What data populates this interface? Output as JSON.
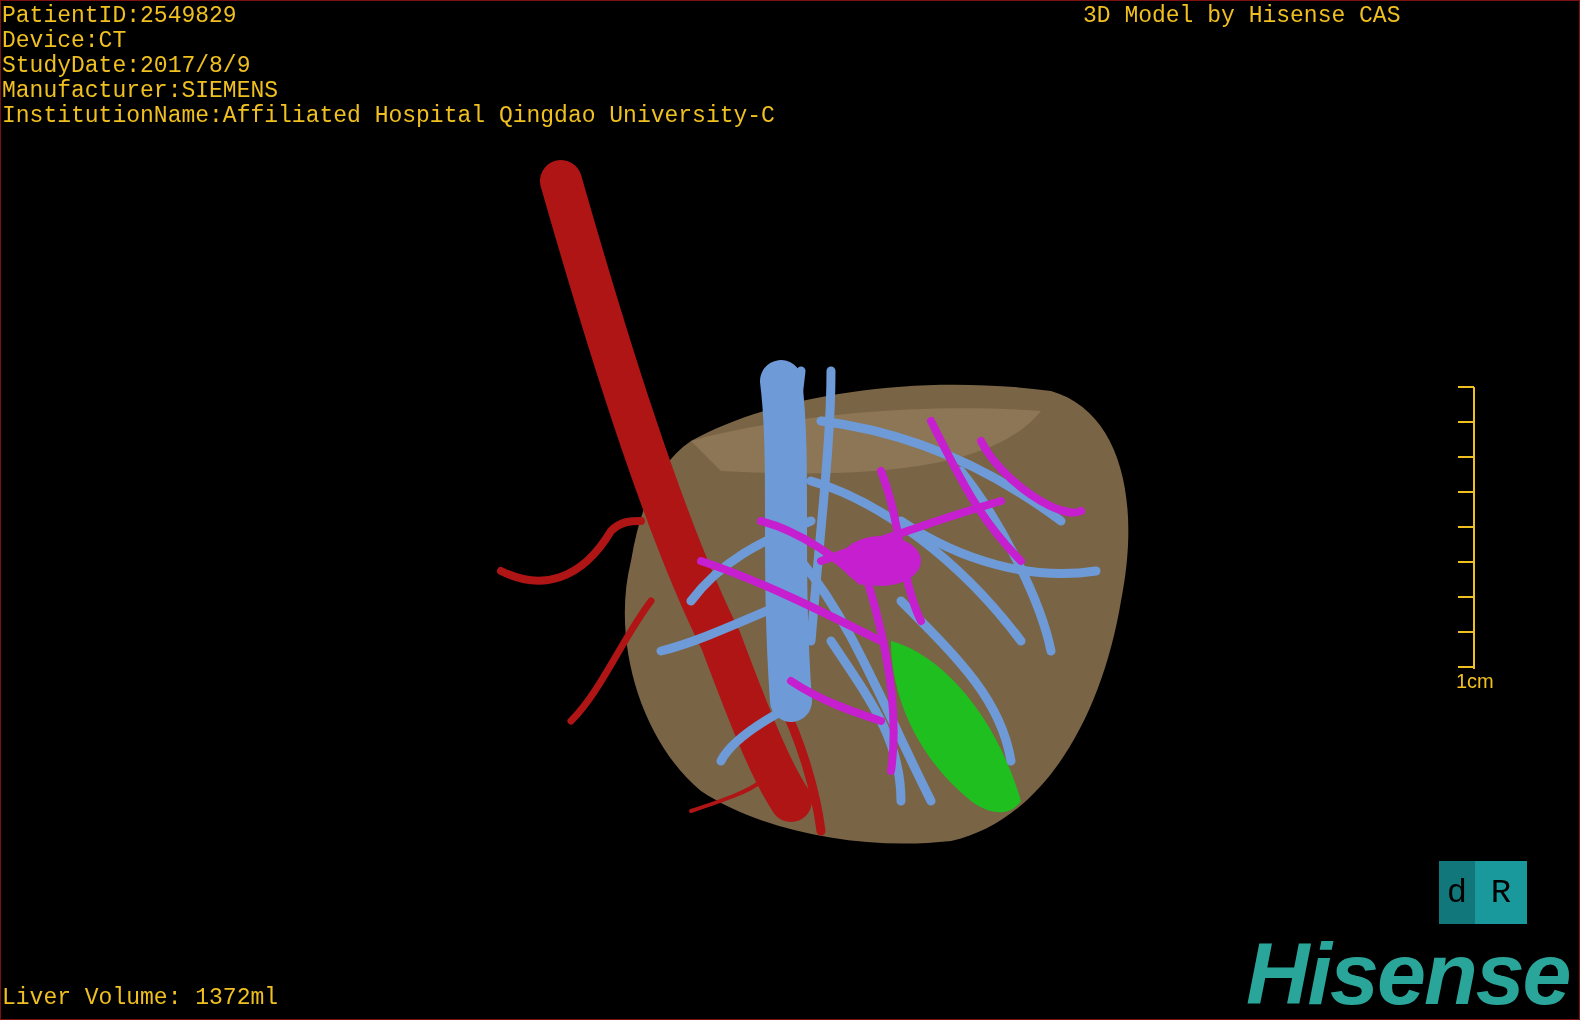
{
  "info_lines": [
    "PatientID:2549829",
    "Device:CT",
    "StudyDate:2017/8/9",
    "Manufacturer:SIEMENS",
    "InstitutionName:Affiliated Hospital Qingdao University-C"
  ],
  "title": "3D Model by Hisense CAS",
  "scale_bar": {
    "label": "1cm"
  },
  "orientation_cube": {
    "faces": [
      "d",
      "R"
    ]
  },
  "logo": "Hisense",
  "liver_volume": "Liver Volume: 1372ml"
}
